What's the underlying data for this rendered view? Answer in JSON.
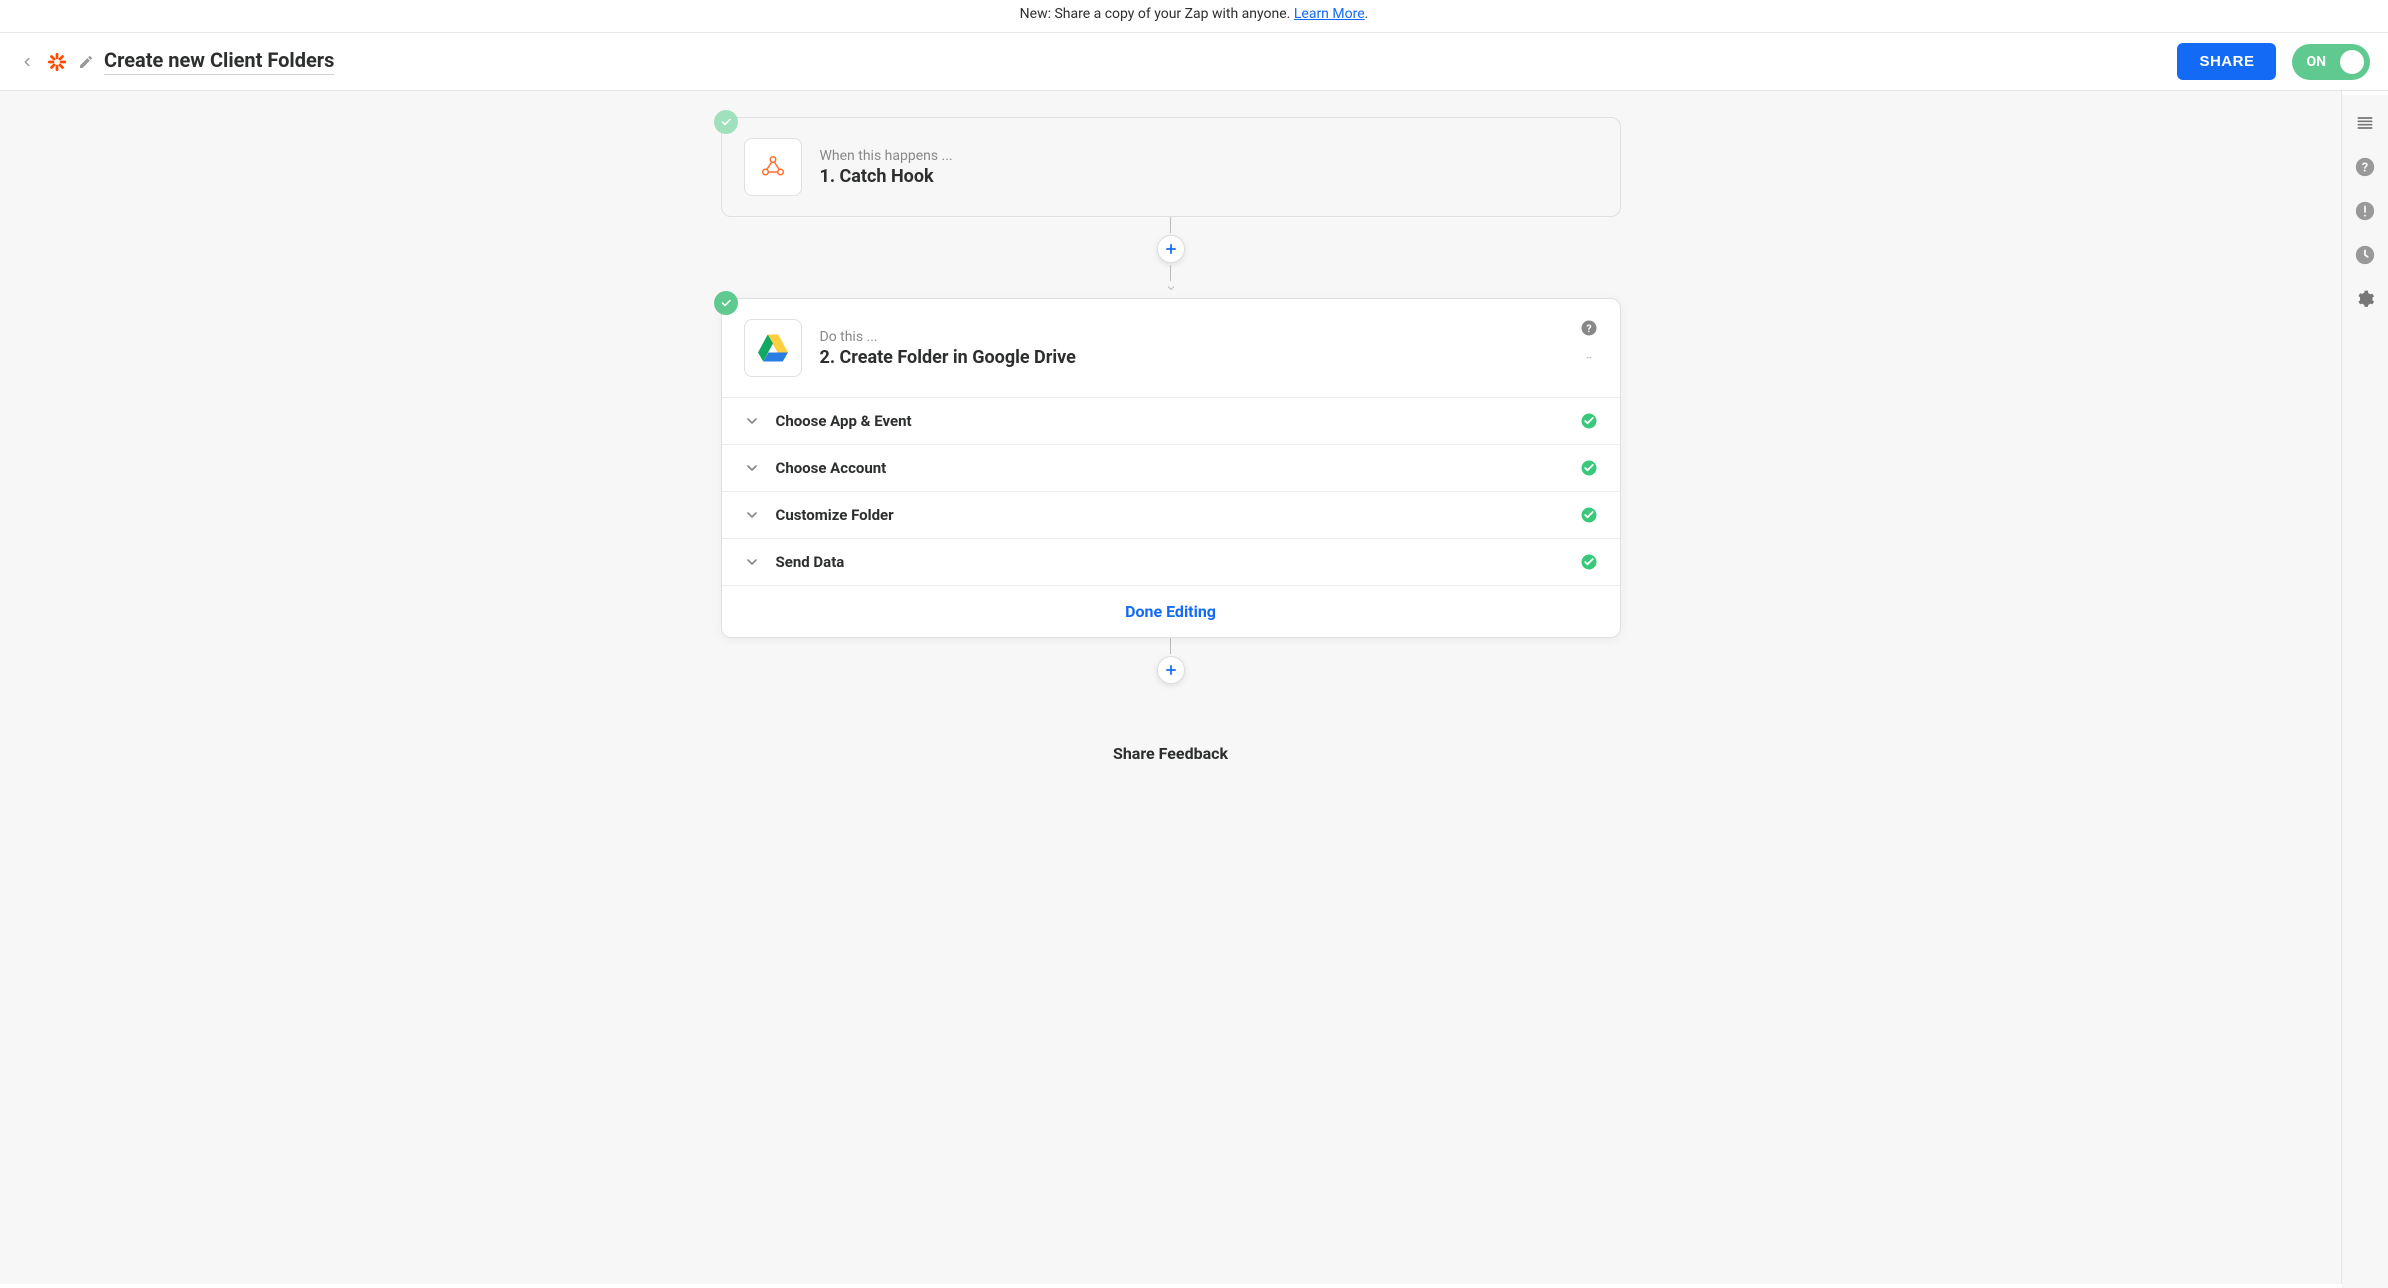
{
  "banner": {
    "text": "New: Share a copy of your Zap with anyone. ",
    "link_text": "Learn More",
    "suffix": "."
  },
  "header": {
    "title": "Create new Client Folders",
    "share_label": "SHARE",
    "toggle_label": "ON"
  },
  "steps": {
    "trigger": {
      "overline": "When this happens ...",
      "title": "1. Catch Hook"
    },
    "action": {
      "overline": "Do this ...",
      "title": "2. Create Folder in Google Drive",
      "substeps": [
        {
          "label": "Choose App & Event",
          "complete": true
        },
        {
          "label": "Choose Account",
          "complete": true
        },
        {
          "label": "Customize Folder",
          "complete": true
        },
        {
          "label": "Send Data",
          "complete": true
        }
      ],
      "done_label": "Done Editing"
    }
  },
  "feedback_label": "Share Feedback"
}
